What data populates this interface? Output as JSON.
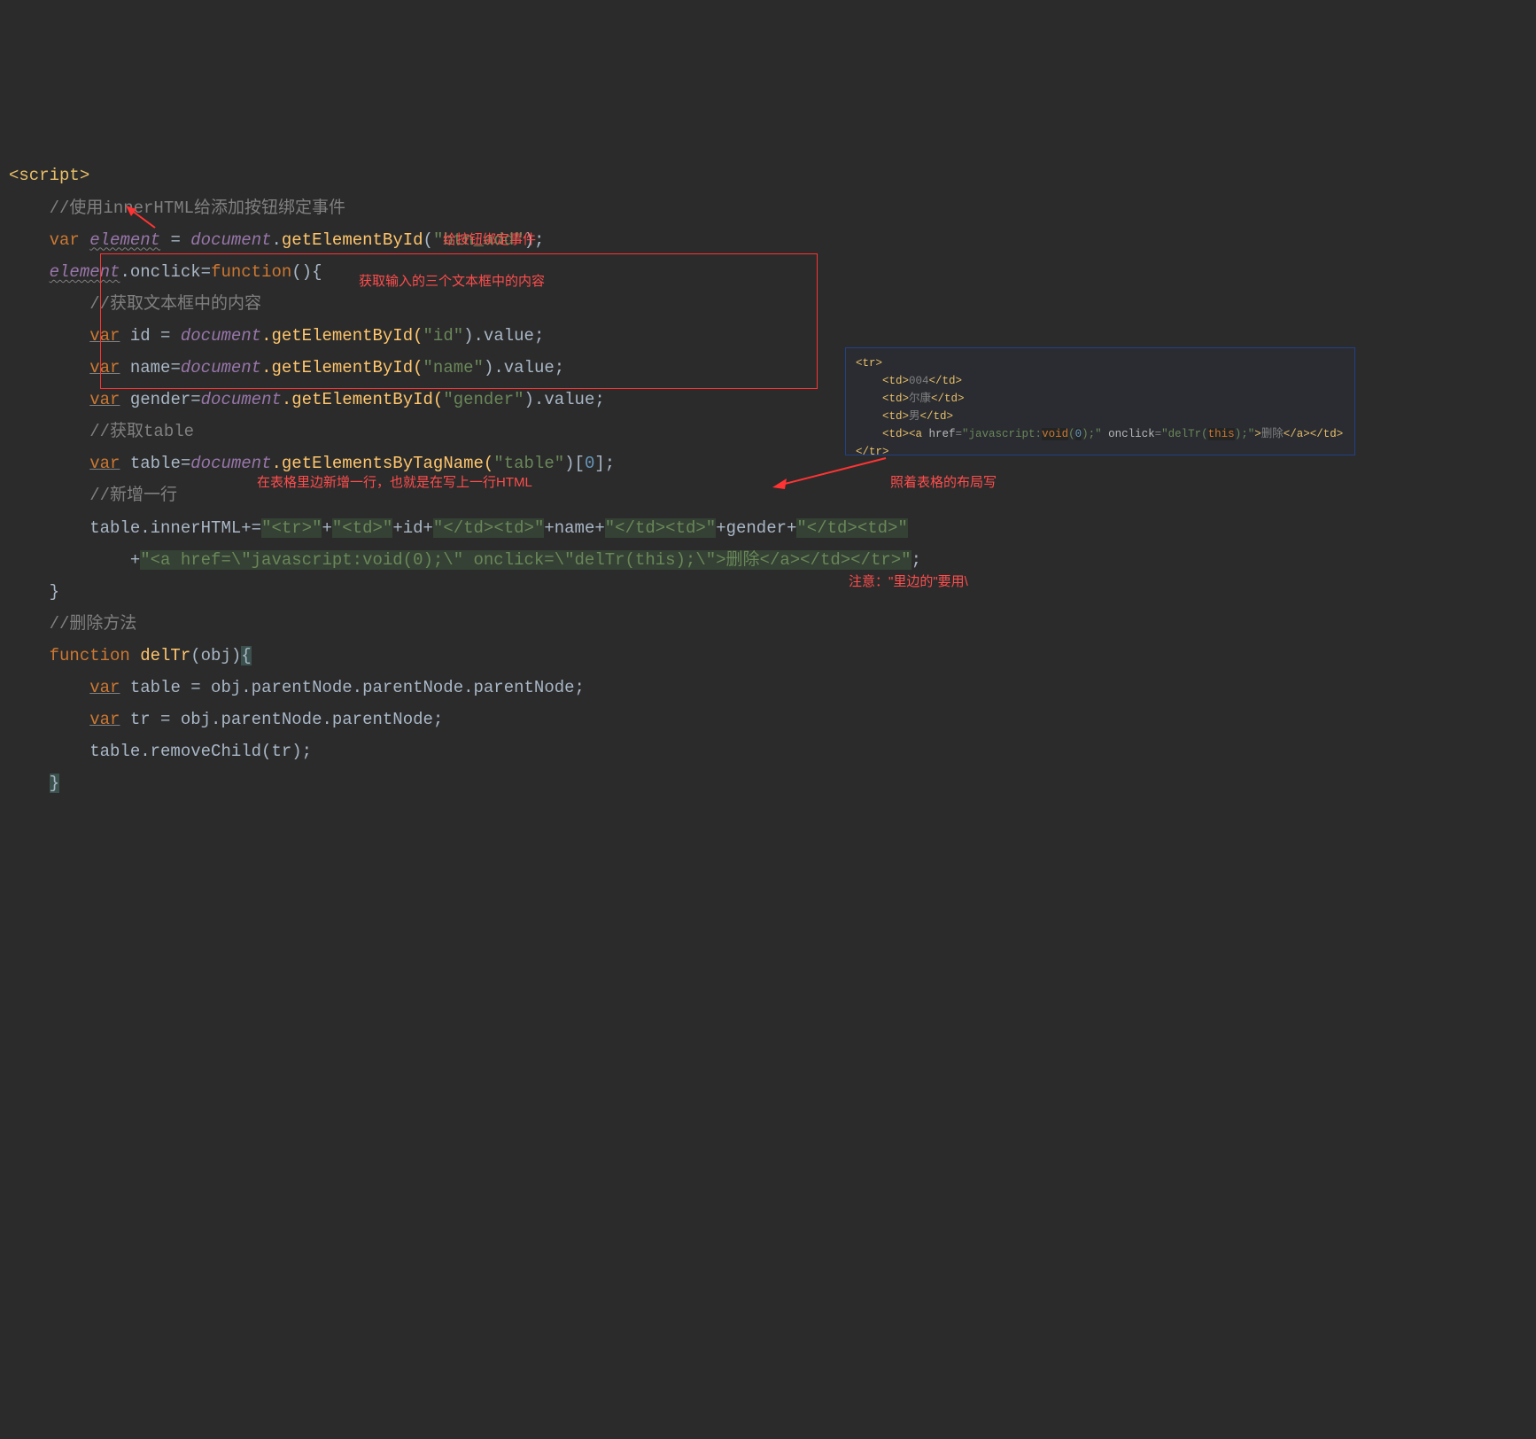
{
  "code": {
    "line1": "<script>",
    "line2_comment": "//使用innerHTML给添加按钮绑定事件",
    "line3_var": "var",
    "line3_element": "element",
    "line3_eq": " = ",
    "line3_document": "document",
    "line3_dot": ".",
    "line3_method": "getElementById",
    "line3_arg": "\"btn_add\"",
    "line3_end": ");",
    "line4_element": "element",
    "line4_onclick": ".onclick=",
    "line4_function": "function",
    "line4_parens": "(){",
    "line5_comment": "//获取文本框中的内容",
    "line6_var": "var",
    "line6_id": " id = ",
    "line6_document": "document",
    "line6_method": ".getElementById(",
    "line6_arg": "\"id\"",
    "line6_end": ").value;",
    "line7_var": "var",
    "line7_name": " name=",
    "line7_document": "document",
    "line7_method": ".getElementById(",
    "line7_arg": "\"name\"",
    "line7_end": ").value;",
    "line8_var": "var",
    "line8_gender": " gender=",
    "line8_document": "document",
    "line8_method": ".getElementById(",
    "line8_arg": "\"gender\"",
    "line8_end": ").value;",
    "line9_comment": "//获取table",
    "line10_var": "var",
    "line10_table": " table=",
    "line10_document": "document",
    "line10_method": ".getElementsByTagName(",
    "line10_arg": "\"table\"",
    "line10_bracket": ")[",
    "line10_zero": "0",
    "line10_end": "];",
    "line11_comment": "//新增一行",
    "line12_table": "table.innerHTML+=",
    "line12_s1": "\"<tr>\"",
    "line12_p1": "+",
    "line12_s2": "\"<td>\"",
    "line12_p2": "+id+",
    "line12_s3": "\"</td><td>\"",
    "line12_p3": "+name+",
    "line12_s4": "\"</td><td>\"",
    "line12_p4": "+gender+",
    "line12_s5": "\"</td><td>\"",
    "line13_p1": "+",
    "line13_s1": "\"<a href=\\\"javascript:void(0);\\\" onclick=\\\"delTr(this);\\\">删除</a></td></tr>\"",
    "line13_end": ";",
    "line14_brace": "}",
    "line15_comment": "//删除方法",
    "line16_function": "function",
    "line16_name": " delTr",
    "line16_obj": "(obj)",
    "line16_brace": "{",
    "line17_var": "var",
    "line17_rest": " table = obj.parentNode.parentNode.parentNode;",
    "line18_var": "var",
    "line18_rest": " tr = obj.parentNode.parentNode;",
    "line19": "table.removeChild(tr);",
    "line20_brace": "}"
  },
  "annotations": {
    "a1": "给按钮绑定事件",
    "a2": "获取输入的三个文本框中的内容",
    "a3": "在表格里边新增一行，也就是在写上一行HTML",
    "a4": "照着表格的布局写",
    "a5": "注意：\"里边的\"要用\\"
  },
  "tooltip": {
    "l1": "<tr>",
    "l2a": "    <td>",
    "l2b": "004",
    "l2c": "</td>",
    "l3a": "    <td>",
    "l3b": "尔康",
    "l3c": "</td>",
    "l4a": "    <td>",
    "l4b": "男",
    "l4c": "</td>",
    "l5a": "    <td><a ",
    "l5b": "href",
    "l5c": "=",
    "l5d": "\"javascript:",
    "l5e": "void",
    "l5f": "(",
    "l5g": "0",
    "l5h": ");\"",
    "l5i": " onclick",
    "l5j": "=",
    "l5k": "\"delTr(",
    "l5l": "this",
    "l5m": ");\"",
    "l5n": ">",
    "l5o": "删除",
    "l5p": "</a></td>",
    "l6": "</tr>"
  }
}
